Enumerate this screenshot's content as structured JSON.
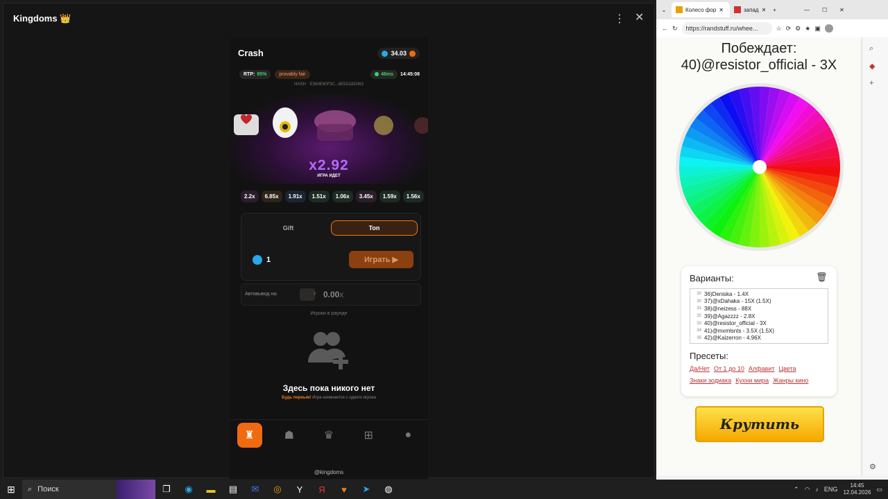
{
  "app": {
    "title": "Kingdoms 👑",
    "menu_icon": "⋮",
    "close_icon": "✕"
  },
  "game": {
    "title": "Crash",
    "balance": "34.03",
    "rtp_label": "RTP:",
    "rtp_value": "95%",
    "fair": "provably fair",
    "ping": "46ms",
    "time": "14:45:08",
    "hash_label": "HASH",
    "hash_value": "E360E80F3C...6E5D18D063",
    "multiplier": "x2.92",
    "status": "ИГРА ИДЕТ",
    "history": [
      "2.2x",
      "6.85x",
      "1.91x",
      "1.51x",
      "1.06x",
      "3.45x",
      "1.59x",
      "1.56x"
    ],
    "tab_gift": "Gift",
    "tab_ton": "Ton",
    "amount": "1",
    "play": "Играть",
    "auto_label": "Автовывод на:",
    "auto_value": "0.00",
    "auto_suffix": "x",
    "players_label": "Игроки в раунде",
    "empty": "Здесь пока никого нет",
    "empty_sub_a": "Будь первым!",
    "empty_sub_b": "Игра начинается с одного игрока",
    "handle": "@kingdoms",
    "accent": "#f06a10"
  },
  "browser": {
    "tab1": "Колесо фор",
    "tab2": "запад",
    "url": "https://randstuff.ru/whee...",
    "winner_label": "Побеждает:",
    "winner": "40)@resistor_official - 3X",
    "options_title": "Варианты:",
    "options": [
      {
        "n": "30",
        "t": "36)Deniska - 1.4X"
      },
      {
        "n": "30",
        "t": "37)@xDahaka - 15X (1.5X)"
      },
      {
        "n": "31",
        "t": "38)@neizess - 88X"
      },
      {
        "n": "32",
        "t": "39)@Agazzzz - 2.8X"
      },
      {
        "n": "33",
        "t": "40)@resistor_official - 3X"
      },
      {
        "n": "34",
        "t": "41)@mxmlsnts - 3.5X (1.5X)"
      },
      {
        "n": "35",
        "t": "42)@Kaizerron - 4.96X"
      }
    ],
    "presets_title": "Пресеты:",
    "presets": [
      "Да/Нет",
      "От 1 до 10",
      "Алфавит",
      "Цвета",
      "Знаки зодиака",
      "Кухни мира",
      "Жанры кино"
    ],
    "spin": "Крутить"
  },
  "taskbar": {
    "search": "Поиск",
    "lang": "ENG",
    "time": "14:45",
    "date": "12.04.2026"
  }
}
